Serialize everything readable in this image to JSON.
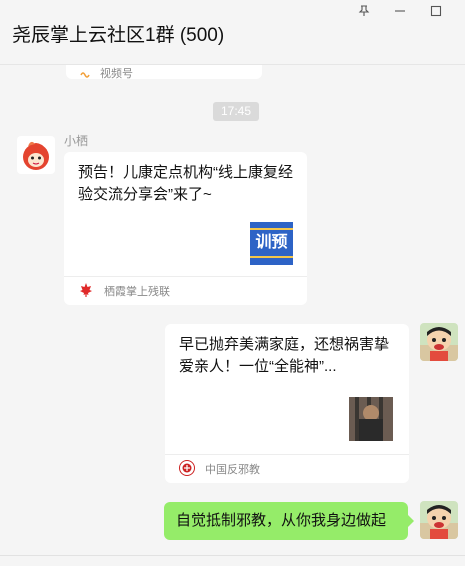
{
  "window": {
    "title": "尧辰掌上云社区1群 (500)"
  },
  "chat": {
    "partial_card_source": "视频号",
    "timestamp": "17:45",
    "messages": [
      {
        "sender": "小栖",
        "title": "预告！儿康定点机构“线上康复经验交流分享会”来了~",
        "thumb_text": "训预",
        "source": "栖霞掌上残联"
      },
      {
        "title": "早已抛弃美满家庭，还想祸害挚爱亲人！一位“全能神”...",
        "source": "中国反邪教"
      },
      {
        "text": "自觉抵制邪教，从你我身边做起"
      }
    ]
  },
  "colors": {
    "background": "#f5f5f5",
    "bubble_green": "#95ec69",
    "card": "#ffffff",
    "pin_icon": "pin-icon",
    "minimize_icon": "minimize-icon",
    "maximize_icon": "maximize-icon"
  }
}
